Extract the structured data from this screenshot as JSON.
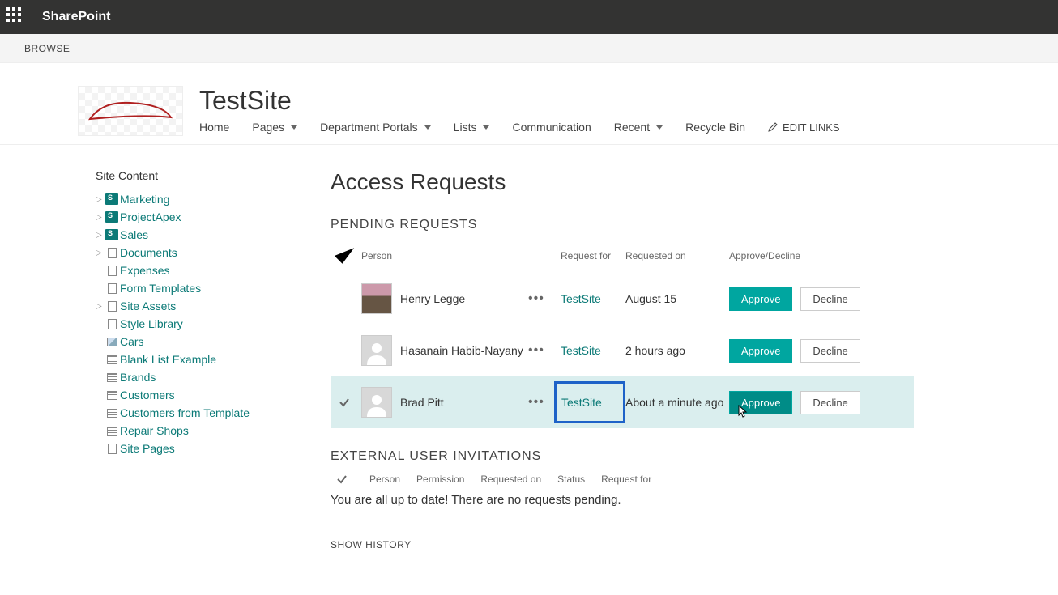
{
  "suitebar": {
    "product": "SharePoint"
  },
  "ribbon": {
    "tab": "BROWSE"
  },
  "header": {
    "site_title": "TestSite",
    "nav": [
      {
        "label": "Home",
        "has_dropdown": false
      },
      {
        "label": "Pages",
        "has_dropdown": true
      },
      {
        "label": "Department Portals",
        "has_dropdown": true
      },
      {
        "label": "Lists",
        "has_dropdown": true
      },
      {
        "label": "Communication",
        "has_dropdown": false
      },
      {
        "label": "Recent",
        "has_dropdown": true
      },
      {
        "label": "Recycle Bin",
        "has_dropdown": false
      }
    ],
    "edit_links": "EDIT LINKS"
  },
  "sidebar": {
    "title": "Site Content",
    "items": [
      {
        "label": "Marketing",
        "icon": "sp",
        "expandable": true
      },
      {
        "label": "ProjectApex",
        "icon": "sp",
        "expandable": true
      },
      {
        "label": "Sales",
        "icon": "sp",
        "expandable": true
      },
      {
        "label": "Documents",
        "icon": "doc",
        "expandable": true
      },
      {
        "label": "Expenses",
        "icon": "doc",
        "expandable": false
      },
      {
        "label": "Form Templates",
        "icon": "doc",
        "expandable": false
      },
      {
        "label": "Site Assets",
        "icon": "doc",
        "expandable": true
      },
      {
        "label": "Style Library",
        "icon": "doc",
        "expandable": false
      },
      {
        "label": "Cars",
        "icon": "img",
        "expandable": false
      },
      {
        "label": "Blank List Example",
        "icon": "list",
        "expandable": false
      },
      {
        "label": "Brands",
        "icon": "list",
        "expandable": false
      },
      {
        "label": "Customers",
        "icon": "list",
        "expandable": false
      },
      {
        "label": "Customers from Template",
        "icon": "list",
        "expandable": false
      },
      {
        "label": "Repair Shops",
        "icon": "list",
        "expandable": false
      },
      {
        "label": "Site Pages",
        "icon": "doc",
        "expandable": false
      }
    ]
  },
  "main": {
    "page_title": "Access Requests",
    "pending": {
      "title": "PENDING REQUESTS",
      "columns": {
        "person": "Person",
        "request_for": "Request for",
        "requested_on": "Requested on",
        "approve_decline": "Approve/Decline"
      },
      "approve_label": "Approve",
      "decline_label": "Decline",
      "rows": [
        {
          "name": "Henry Legge",
          "request_for": "TestSite",
          "requested_on": "August 15",
          "selected": false,
          "avatar": "photo",
          "highlighted": false,
          "hover": false
        },
        {
          "name": "Hasanain Habib-Nayany",
          "request_for": "TestSite",
          "requested_on": "2 hours ago",
          "selected": false,
          "avatar": "blank",
          "highlighted": false,
          "hover": false
        },
        {
          "name": "Brad Pitt",
          "request_for": "TestSite",
          "requested_on": "About a minute ago",
          "selected": true,
          "avatar": "blank",
          "highlighted": true,
          "hover": true
        }
      ]
    },
    "external": {
      "title": "EXTERNAL USER INVITATIONS",
      "columns": [
        "Person",
        "Permission",
        "Requested on",
        "Status",
        "Request for"
      ],
      "empty": "You are all up to date! There are no requests pending."
    },
    "show_history": "SHOW HISTORY"
  }
}
